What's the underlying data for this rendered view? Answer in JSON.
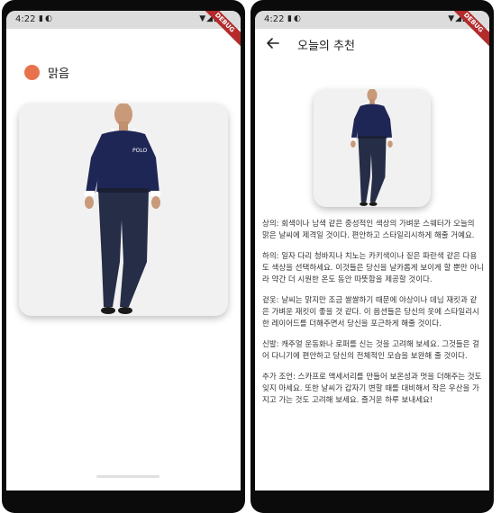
{
  "status_bar": {
    "time": "4:22",
    "debug_label": "DEBUG"
  },
  "home_screen": {
    "weather": {
      "label": "맑음",
      "dot_color": "#e8724d"
    },
    "outfit_image": {
      "icon": "outfit-photo",
      "shirt_logo": "POLO"
    }
  },
  "recommendation_screen": {
    "title": "오늘의 추천",
    "back_icon": "arrow-left",
    "paragraphs": [
      "상의: 회색이나 남색 같은 중성적인 색상의 가벼운 스웨터가 오늘의 맑은 날씨에 제격일 것이다. 편안하고 스타일리시하게 해줄 거예요.",
      "하의: 일자 다리 청바지나 치노는 카키색이나 짙은 파란색 같은 다용도 색상을 선택하세요. 이것들은 당신을 날카롭게 보이게 할 뿐만 아니라 약간 더 시원한 온도 동안 따뜻함을 제공할 것이다.",
      "겉옷: 날씨는 맑지만 조금 쌀쌀하기 때문에 야상이나 데님 재킷과 같은 가벼운 재킷이 좋을 것 같다. 이 옵션들은 당신의 옷에 스타일리시한 레이어드를 더해주면서 당신을 포근하게 해줄 것이다.",
      "신발: 캐주얼 운동화나 로퍼를 신는 것을 고려해 보세요. 그것들은 걸어 다니기에 편안하고 당신의 전체적인 모습을 보완해 줄 것이다.",
      "추가 조언: 스카프로 액세서리를 만들어 보온성과 멋을 더해주는 것도 잊지 마세요. 또한 날씨가 갑자기 변할 때를 대비해서 작은 우산을 가지고 가는 것도 고려해 보세요. 즐거운 하루 보내세요!"
    ]
  },
  "colors": {
    "shirt": "#1e2656",
    "pants": "#262d47",
    "accent_dot": "#e8724d",
    "card_bg": "#f1f1f1"
  }
}
